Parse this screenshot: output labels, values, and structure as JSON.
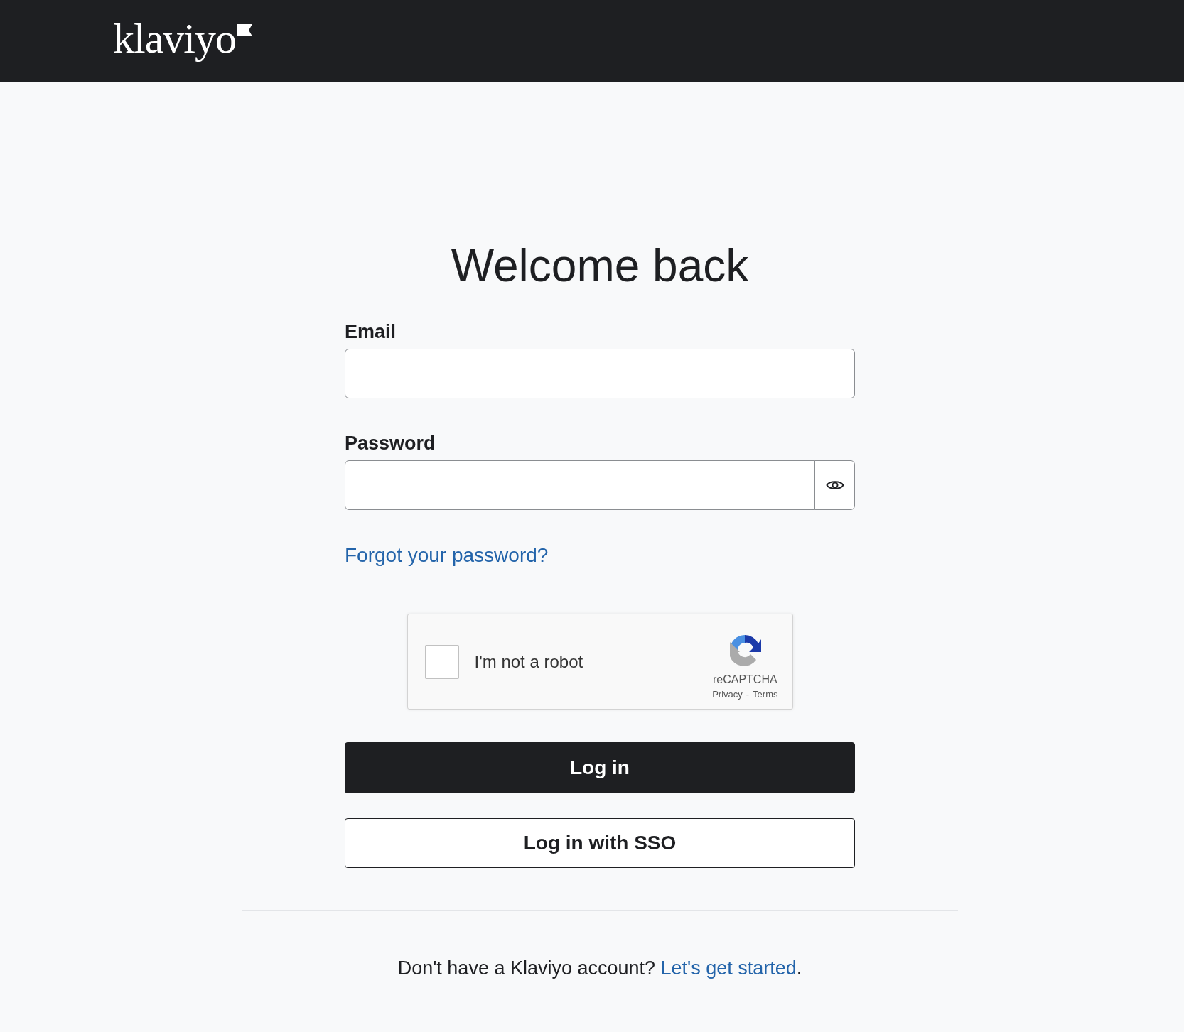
{
  "header": {
    "logo": "klaviyo"
  },
  "title": "Welcome back",
  "fields": [
    {
      "kind": "text",
      "label": "Email"
    },
    {
      "kind": "password",
      "label": "Password"
    }
  ],
  "forgot_link": "Forgot your password?",
  "captcha": {
    "label": "I'm not a robot",
    "checked": false,
    "brand": "reCAPTCHA",
    "privacy": "Privacy",
    "separator": "-",
    "terms": "Terms"
  },
  "buttons": [
    {
      "label": "Log in",
      "kind": "primary"
    },
    {
      "label": "Log in with SSO",
      "kind": "secondary"
    }
  ],
  "footer": {
    "text": "Don't have a Klaviyo account?",
    "link": "Let's get started",
    "end": "."
  }
}
